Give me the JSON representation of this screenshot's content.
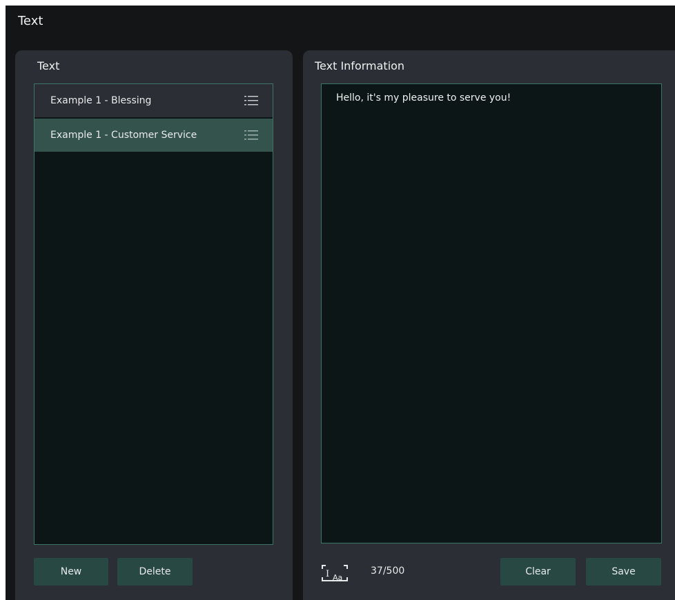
{
  "app": {
    "title": "Text"
  },
  "left_panel": {
    "title": "Text",
    "items": [
      {
        "label": "Example 1 - Blessing",
        "icon": "list-icon",
        "selected": false
      },
      {
        "label": "Example 1 - Customer Service",
        "icon": "list-icon",
        "selected": true
      }
    ],
    "new_label": "New",
    "delete_label": "Delete"
  },
  "right_panel": {
    "title": "Text Information",
    "content": "Hello, it's my pleasure to serve you!",
    "font_icon": "text-font-icon",
    "char_count": "37/500",
    "clear_label": "Clear",
    "save_label": "Save"
  },
  "colors": {
    "background": "#141517",
    "panel": "#2b2e34",
    "box": "#0d1616",
    "border": "#3d7566",
    "selected": "#35534d",
    "button": "#274843"
  }
}
